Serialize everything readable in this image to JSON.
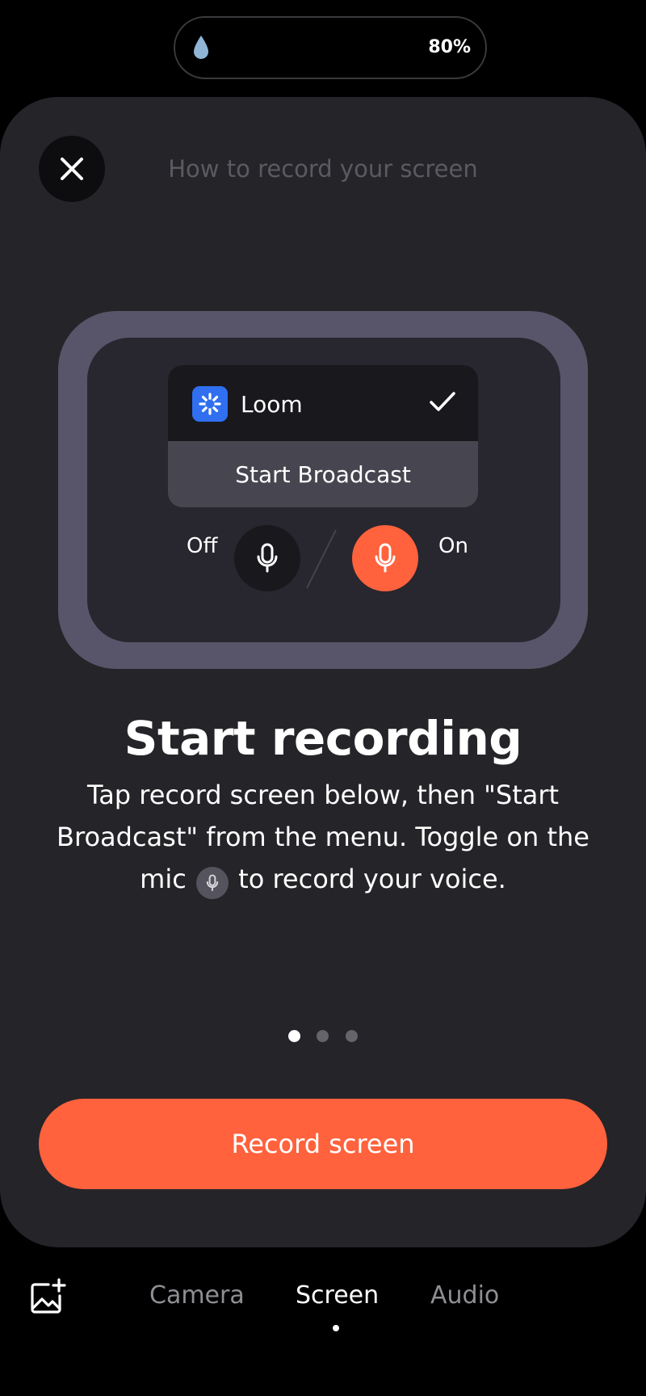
{
  "status_bar": {
    "battery": "80%",
    "icon": "water-drop-icon"
  },
  "sheet": {
    "title": "How to record your screen",
    "close_icon": "close-icon"
  },
  "illustration": {
    "app_name": "Loom",
    "app_icon": "loom-logo-icon",
    "selected_icon": "checkmark-icon",
    "action_label": "Start Broadcast",
    "mic_off_label": "Off",
    "mic_on_label": "On",
    "mic_on_color": "#ff623d"
  },
  "step": {
    "heading": "Start recording",
    "desc_line1": "Tap record screen below, then \"Start",
    "desc_line2": "Broadcast\" from the menu. Toggle on the",
    "desc_line3_before": "mic",
    "desc_line3_after": "to record your voice."
  },
  "pagination": {
    "total": 3,
    "current": 1
  },
  "primary_action": {
    "label": "Record screen",
    "color": "#ff623d"
  },
  "bottom_nav": {
    "gallery_icon": "add-image-icon",
    "tabs": [
      {
        "label": "Camera",
        "active": false
      },
      {
        "label": "Screen",
        "active": true
      },
      {
        "label": "Audio",
        "active": false
      }
    ]
  }
}
